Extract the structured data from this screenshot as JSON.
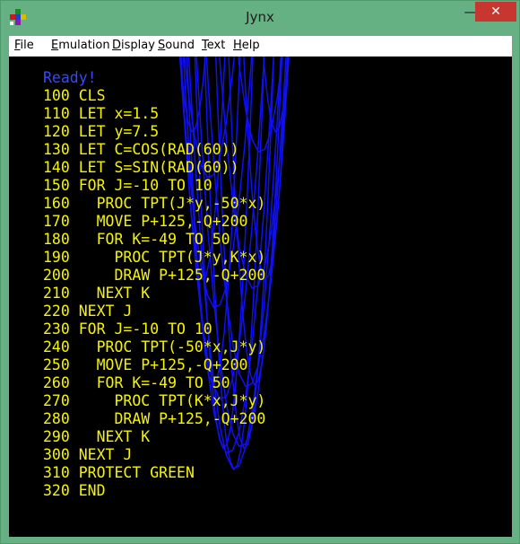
{
  "window": {
    "title": "Jynx",
    "minimize_glyph": "—",
    "close_glyph": "✕"
  },
  "menu": [
    {
      "label": "File",
      "accel": "F",
      "rest": "ile"
    },
    {
      "label": "Emulation",
      "accel": "E",
      "rest": "mulation"
    },
    {
      "label": "Display",
      "accel": "D",
      "rest": "isplay"
    },
    {
      "label": "Sound",
      "accel": "S",
      "rest": "ound"
    },
    {
      "label": "Text",
      "accel": "T",
      "rest": "ext"
    },
    {
      "label": "Help",
      "accel": "H",
      "rest": "elp"
    }
  ],
  "screen": {
    "ready": "Ready!",
    "program": [
      "100 CLS",
      "110 LET x=1.5",
      "120 LET y=7.5",
      "130 LET C=COS(RAD(60))",
      "140 LET S=SIN(RAD(60))",
      "150 FOR J=-10 TO 10",
      "160   PROC TPT(J*y,-50*x)",
      "170   MOVE P+125,-Q+200",
      "180   FOR K=-49 TO 50",
      "190     PROC TPT(J*y,K*x)",
      "200     DRAW P+125,-Q+200",
      "210   NEXT K",
      "220 NEXT J",
      "230 FOR J=-10 TO 10",
      "240   PROC TPT(-50*x,J*y)",
      "250   MOVE P+125,-Q+200",
      "260   FOR K=-49 TO 50",
      "270     PROC TPT(K*x,J*y)",
      "280     DRAW P+125,-Q+200",
      "290   NEXT K",
      "300 NEXT J",
      "310 PROTECT GREEN",
      "320 END"
    ],
    "colors": {
      "background": "#000000",
      "text": "#f6f400",
      "ready": "#3848ff",
      "mesh": "#1010f0"
    },
    "mesh_rows_visible_behind": "OOCLST BLUE"
  }
}
